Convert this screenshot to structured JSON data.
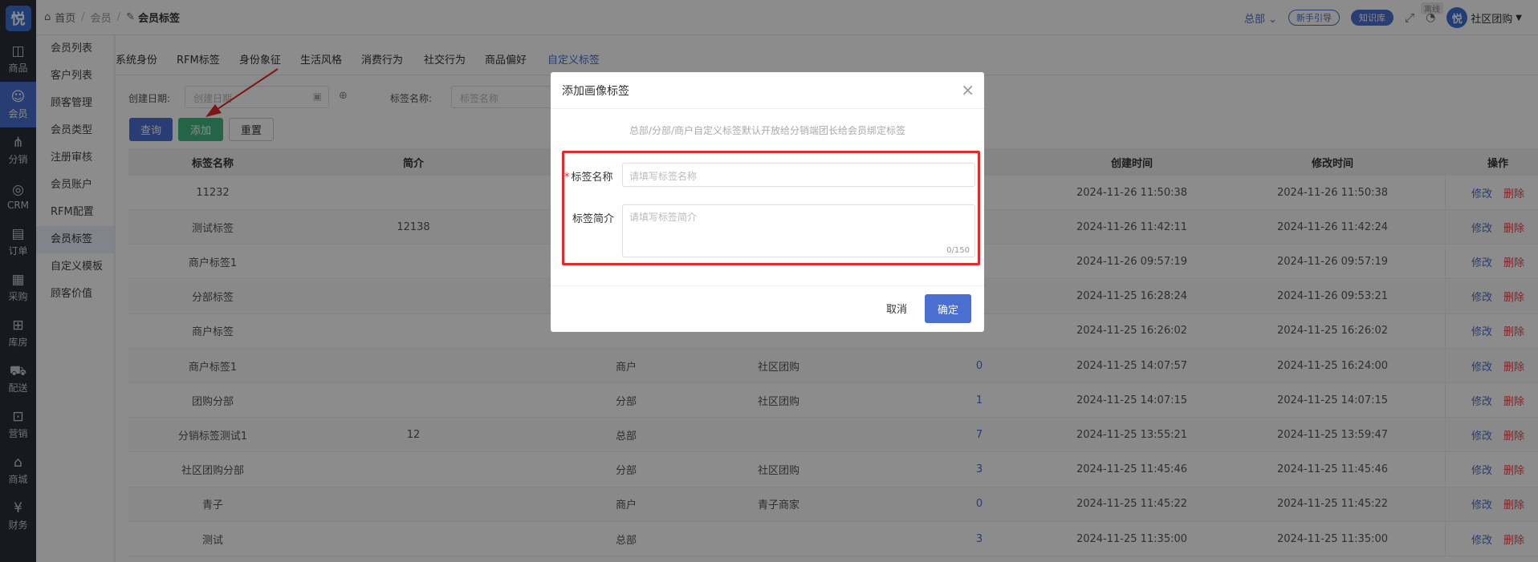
{
  "app": {
    "logo": "悦"
  },
  "rail": [
    {
      "label": "商品",
      "icon": "bag-icon",
      "glyph": "◫"
    },
    {
      "label": "会员",
      "icon": "user-icon",
      "glyph": "☺"
    },
    {
      "label": "分销",
      "icon": "network-icon",
      "glyph": "⋔"
    },
    {
      "label": "CRM",
      "icon": "crm-icon",
      "glyph": "◎"
    },
    {
      "label": "订单",
      "icon": "order-icon",
      "glyph": "▤"
    },
    {
      "label": "采购",
      "icon": "purchase-icon",
      "glyph": "▦"
    },
    {
      "label": "库房",
      "icon": "warehouse-icon",
      "glyph": "⊞"
    },
    {
      "label": "配送",
      "icon": "truck-icon",
      "glyph": "⛟"
    },
    {
      "label": "营销",
      "icon": "gift-icon",
      "glyph": "⊡"
    },
    {
      "label": "商城",
      "icon": "shop-icon",
      "glyph": "⌂"
    },
    {
      "label": "财务",
      "icon": "yen-icon",
      "glyph": "¥"
    }
  ],
  "sidebar": [
    "会员列表",
    "客户列表",
    "顾客管理",
    "会员类型",
    "注册审核",
    "会员账户",
    "RFM配置",
    "会员标签",
    "自定义模板",
    "顾客价值"
  ],
  "breadcrumb": {
    "home": "首页",
    "level1": "会员",
    "current": "会员标签"
  },
  "header": {
    "org": "总部",
    "guide": "新手引导",
    "kb": "知识库",
    "badge": "离线",
    "user": "社区团购"
  },
  "tabs": [
    "系统身份",
    "RFM标签",
    "身份象征",
    "生活风格",
    "消费行为",
    "社交行为",
    "商品偏好",
    "自定义标签"
  ],
  "filters": {
    "date_label": "创建日期:",
    "date_placeholder": "创建日期",
    "name_label": "标签名称:",
    "name_placeholder": "标签名称"
  },
  "buttons": {
    "query": "查询",
    "add": "添加",
    "reset": "重置"
  },
  "table": {
    "headers": {
      "name": "标签名称",
      "intro": "简介",
      "ct": "创建时间",
      "mt": "修改时间",
      "op": "操作"
    },
    "rows": [
      {
        "name": "11232",
        "intro": "",
        "type": "",
        "store": "",
        "count": "",
        "ct": "2024-11-26 11:50:38",
        "mt": "2024-11-26 11:50:38"
      },
      {
        "name": "测试标签",
        "intro": "12138",
        "type": "",
        "store": "",
        "count": "",
        "ct": "2024-11-26 11:42:11",
        "mt": "2024-11-26 11:42:24"
      },
      {
        "name": "商户标签1",
        "intro": "",
        "type": "",
        "store": "",
        "count": "",
        "ct": "2024-11-26 09:57:19",
        "mt": "2024-11-26 09:57:19"
      },
      {
        "name": "分部标签",
        "intro": "",
        "type": "",
        "store": "",
        "count": "",
        "ct": "2024-11-25 16:28:24",
        "mt": "2024-11-26 09:53:21"
      },
      {
        "name": "商户标签",
        "intro": "",
        "type": "",
        "store": "",
        "count": "",
        "ct": "2024-11-25 16:26:02",
        "mt": "2024-11-25 16:26:02"
      },
      {
        "name": "商户标签1",
        "intro": "",
        "type": "商户",
        "store": "社区团购",
        "count": "0",
        "ct": "2024-11-25 14:07:57",
        "mt": "2024-11-25 16:24:00"
      },
      {
        "name": "团购分部",
        "intro": "",
        "type": "分部",
        "store": "社区团购",
        "count": "1",
        "ct": "2024-11-25 14:07:15",
        "mt": "2024-11-25 14:07:15"
      },
      {
        "name": "分销标签测试1",
        "intro": "12",
        "type": "总部",
        "store": "",
        "count": "7",
        "ct": "2024-11-25 13:55:21",
        "mt": "2024-11-25 13:59:47"
      },
      {
        "name": "社区团购分部",
        "intro": "",
        "type": "分部",
        "store": "社区团购",
        "count": "3",
        "ct": "2024-11-25 11:45:46",
        "mt": "2024-11-25 11:45:46"
      },
      {
        "name": "青子",
        "intro": "",
        "type": "商户",
        "store": "青子商家",
        "count": "0",
        "ct": "2024-11-25 11:45:22",
        "mt": "2024-11-25 11:45:22"
      },
      {
        "name": "测试",
        "intro": "",
        "type": "总部",
        "store": "",
        "count": "3",
        "ct": "2024-11-25 11:35:00",
        "mt": "2024-11-25 11:35:00"
      }
    ],
    "op_edit": "修改",
    "op_delete": "删除"
  },
  "modal": {
    "title": "添加画像标签",
    "hint": "总部/分部/商户自定义标签默认开放给分销端团长给会员绑定标签",
    "name_label": "标签名称",
    "name_placeholder": "请填写标签名称",
    "intro_label": "标签简介",
    "intro_placeholder": "请填写标签简介",
    "counter": "0/150",
    "cancel": "取消",
    "confirm": "确定"
  }
}
